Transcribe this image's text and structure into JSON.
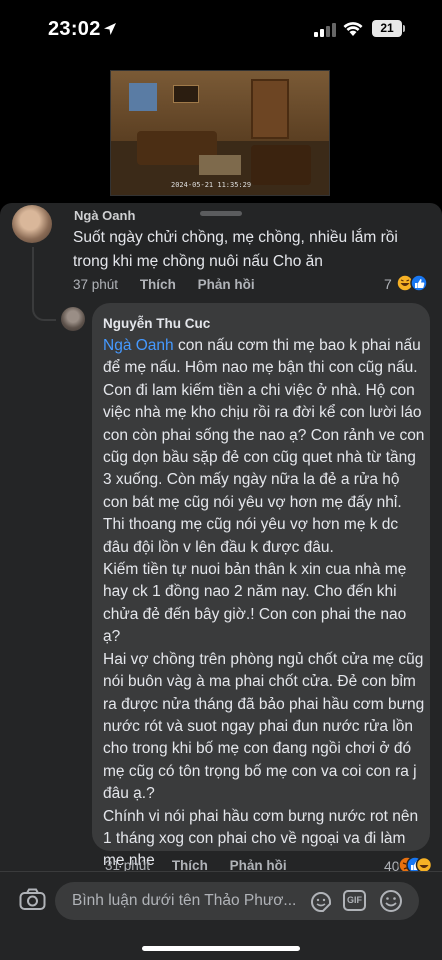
{
  "status_bar": {
    "time": "23:02",
    "battery": "21"
  },
  "comment1": {
    "author": "Ngà Oanh",
    "text": "Suốt ngày chửi chồng, mẹ chồng, nhiều lắm rồi trong khi mẹ chồng nuôi nấu Cho ăn",
    "time": "37 phút",
    "like": "Thích",
    "reply": "Phản hồi",
    "reaction_count": "7"
  },
  "comment2": {
    "author": "Nguyễn Thu Cuc",
    "mention": "Ngà Oanh",
    "text_after_mention": " con nấu cơm thi mẹ bao k phai nấu để mẹ nấu. Hôm nao mẹ bận thi con cũg nấu. Con đi lam kiếm tiền a chi việc ở nhà. Hộ con việc nhà mẹ kho chịu rồi ra đời kể con lười láo con còn phai sống the nao ạ? Con rảnh ve con cũg dọn bầu sặp đẻ con cũg quet nhà từ tầng 3 xuống. Còn mấy ngày nữa la đẻ a rửa hộ con bát mẹ cũg nói yêu vợ hơn mẹ đấy nhỉ.",
    "paragraphs": [
      "Thi thoang mẹ cũg nói yêu vợ hơn mẹ k dc đâu đội lồn v lên đầu k được đâu.",
      "Kiếm tiền tự nuoi bản thân k xin cua nhà mẹ hay ck 1 đồng nao 2 năm nay. Cho đến khi chửa đẻ đến bây giờ.! Con con phai the nao ạ?",
      "Hai vợ chồng trên phòng ngủ chốt cửa mẹ cũg nói buôn vàg à ma phai chốt cửa. Đẻ con bỉm ra được nửa tháng đã bảo phai hầu cơm bưng nước rót và suot ngay phai đun nước rửa lồn cho trong khi bố mẹ con đang ngồi chơi ở đó mẹ cũg có tôn trọng bố mẹ con va coi con ra j đâu ạ.?",
      "Chính vi nói phai hầu cơm bưng nước rot nên 1 tháng xog con phai cho về ngoại va đi làm mẹ nhe"
    ],
    "time": "31 phút",
    "like": "Thích",
    "reply": "Phản hồi",
    "reaction_count": "40"
  },
  "composer": {
    "placeholder": "Bình luận dưới tên Thảo Phươ...",
    "gif_label": "GIF"
  },
  "video": {
    "timestamp": "2024-05-21 11:35:29"
  },
  "colors": {
    "background": "#242526",
    "bubble": "#3a3b3c",
    "mention": "#4599ff",
    "text": "#e4e6eb",
    "muted": "#b0b3b8"
  }
}
